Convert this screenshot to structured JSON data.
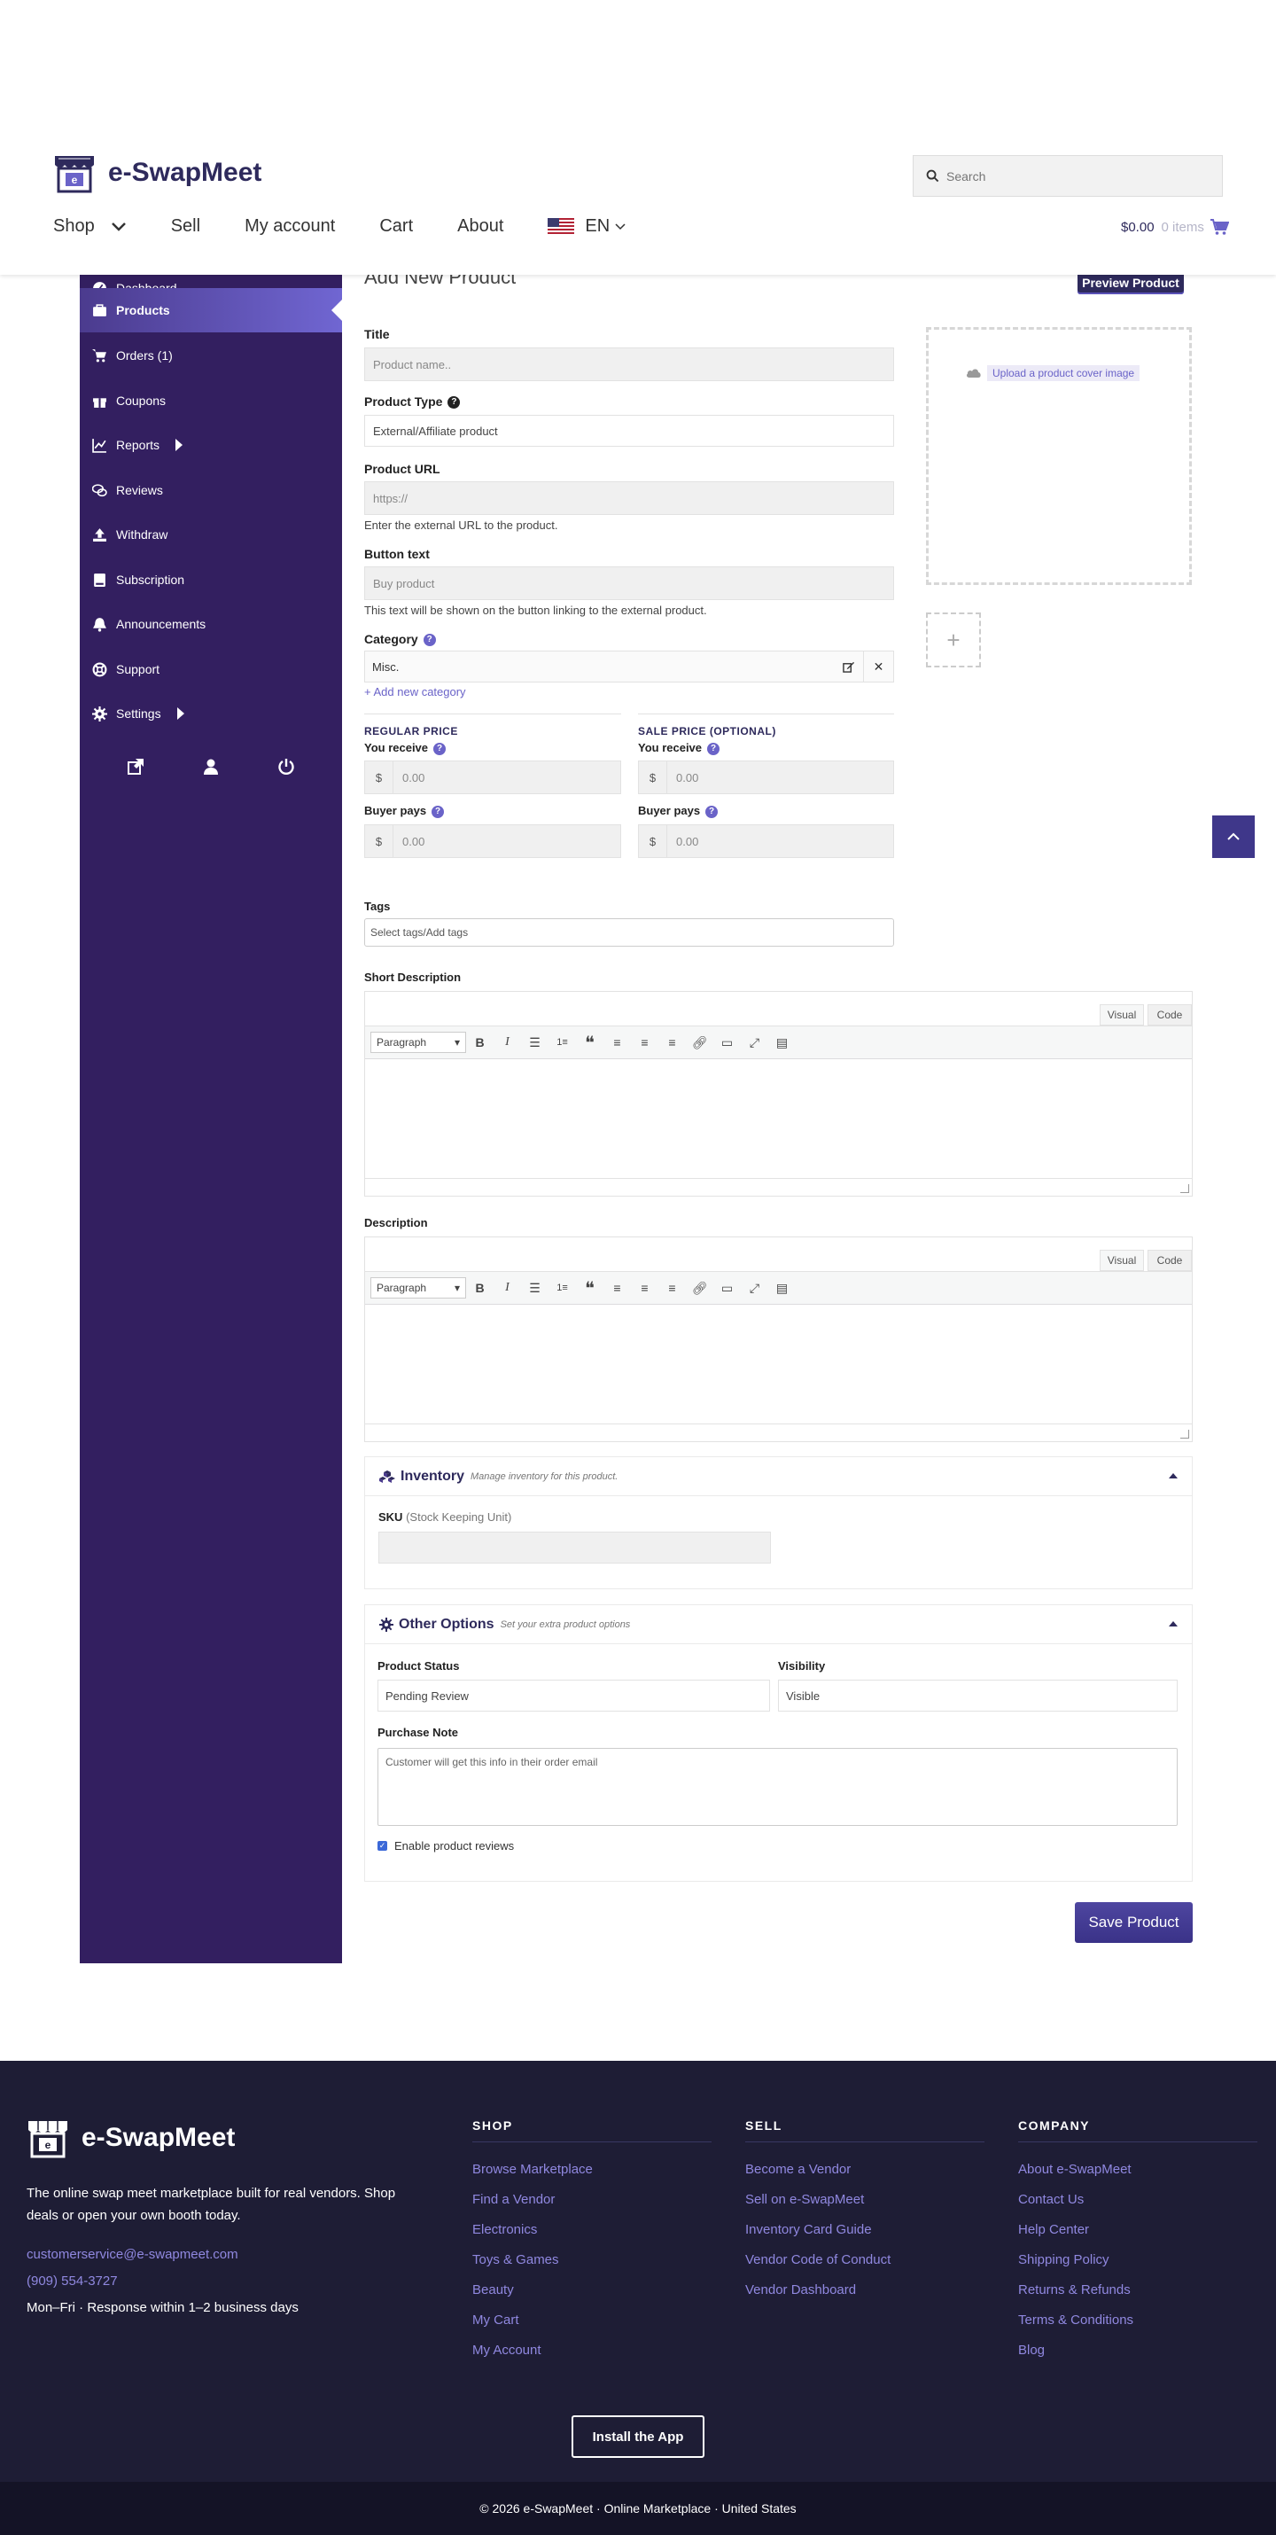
{
  "header": {
    "brand": "e-SwapMeet",
    "search_placeholder": "Search",
    "nav": [
      "Shop",
      "Sell",
      "My account",
      "Cart",
      "About"
    ],
    "language": "EN",
    "cart_total": "$0.00",
    "cart_items": "0 items"
  },
  "sidebar": {
    "items": [
      {
        "label": "Dashboard",
        "icon": "dashboard-icon"
      },
      {
        "label": "Products",
        "icon": "briefcase-icon"
      },
      {
        "label": "Orders (1)",
        "icon": "cart-icon"
      },
      {
        "label": "Coupons",
        "icon": "gift-icon"
      },
      {
        "label": "Reports",
        "icon": "chart-icon"
      },
      {
        "label": "Reviews",
        "icon": "comments-icon"
      },
      {
        "label": "Withdraw",
        "icon": "upload-icon"
      },
      {
        "label": "Subscription",
        "icon": "book-icon"
      },
      {
        "label": "Announcements",
        "icon": "bell-icon"
      },
      {
        "label": "Support",
        "icon": "lifering-icon"
      },
      {
        "label": "Settings",
        "icon": "gear-icon"
      }
    ],
    "active": "Products"
  },
  "form": {
    "page_title": "Add New Product",
    "preview_button": "Preview Product",
    "title_label": "Title",
    "title_placeholder": "Product name..",
    "product_type_label": "Product Type",
    "product_type_value": "External/Affiliate product",
    "product_url_label": "Product URL",
    "product_url_placeholder": "https://",
    "product_url_hint": "Enter the external URL to the product.",
    "button_text_label": "Button text",
    "button_text_placeholder": "Buy product",
    "button_text_hint": "This text will be shown on the button linking to the external product.",
    "category_label": "Category",
    "category_value": "Misc.",
    "add_category": "+ Add new category",
    "regular_price_head": "REGULAR PRICE",
    "sale_price_head": "SALE PRICE (OPTIONAL)",
    "you_receive": "You receive",
    "buyer_pays": "Buyer pays",
    "currency": "$",
    "price_placeholder": "0.00",
    "upload_cover": "Upload a product cover image",
    "gallery_add": "+",
    "tags_label": "Tags",
    "tags_placeholder": "Select tags/Add tags",
    "short_desc_label": "Short Description",
    "desc_label": "Description",
    "editor_visual": "Visual",
    "editor_code": "Code",
    "editor_format": "Paragraph",
    "save_button": "Save Product"
  },
  "inventory": {
    "title": "Inventory",
    "subtitle": "Manage inventory for this product.",
    "sku_label": "SKU",
    "sku_sub": "(Stock Keeping Unit)"
  },
  "other_options": {
    "title": "Other Options",
    "subtitle": "Set your extra product options",
    "status_label": "Product Status",
    "status_value": "Pending Review",
    "visibility_label": "Visibility",
    "visibility_value": "Visible",
    "purchase_note_label": "Purchase Note",
    "purchase_note_placeholder": "Customer will get this info in their order email",
    "reviews_checkbox": "Enable product reviews",
    "reviews_checked": true
  },
  "footer": {
    "brand": "e-SwapMeet",
    "tagline": "The online swap meet marketplace built for real vendors. Shop deals or open your own booth today.",
    "email": "customerservice@e-swapmeet.com",
    "phone": "(909) 554-3727",
    "hours": "Mon–Fri · Response within 1–2 business days",
    "columns": [
      {
        "head": "SHOP",
        "links": [
          "Browse Marketplace",
          "Find a Vendor",
          "Electronics",
          "Toys & Games",
          "Beauty",
          "My Cart",
          "My Account"
        ]
      },
      {
        "head": "SELL",
        "links": [
          "Become a Vendor",
          "Sell on e-SwapMeet",
          "Inventory Card Guide",
          "Vendor Code of Conduct",
          "Vendor Dashboard"
        ]
      },
      {
        "head": "COMPANY",
        "links": [
          "About e-SwapMeet",
          "Contact Us",
          "Help Center",
          "Shipping Policy",
          "Returns & Refunds",
          "Terms & Conditions",
          "Blog"
        ]
      }
    ],
    "install_button": "Install the App",
    "copyright": "© 2026 e-SwapMeet · Online Marketplace · United States"
  },
  "colors": {
    "brand": "#2e2a5c",
    "sidebar": "#331f60",
    "accent": "#6a63c8",
    "footer": "#1e1d35"
  }
}
